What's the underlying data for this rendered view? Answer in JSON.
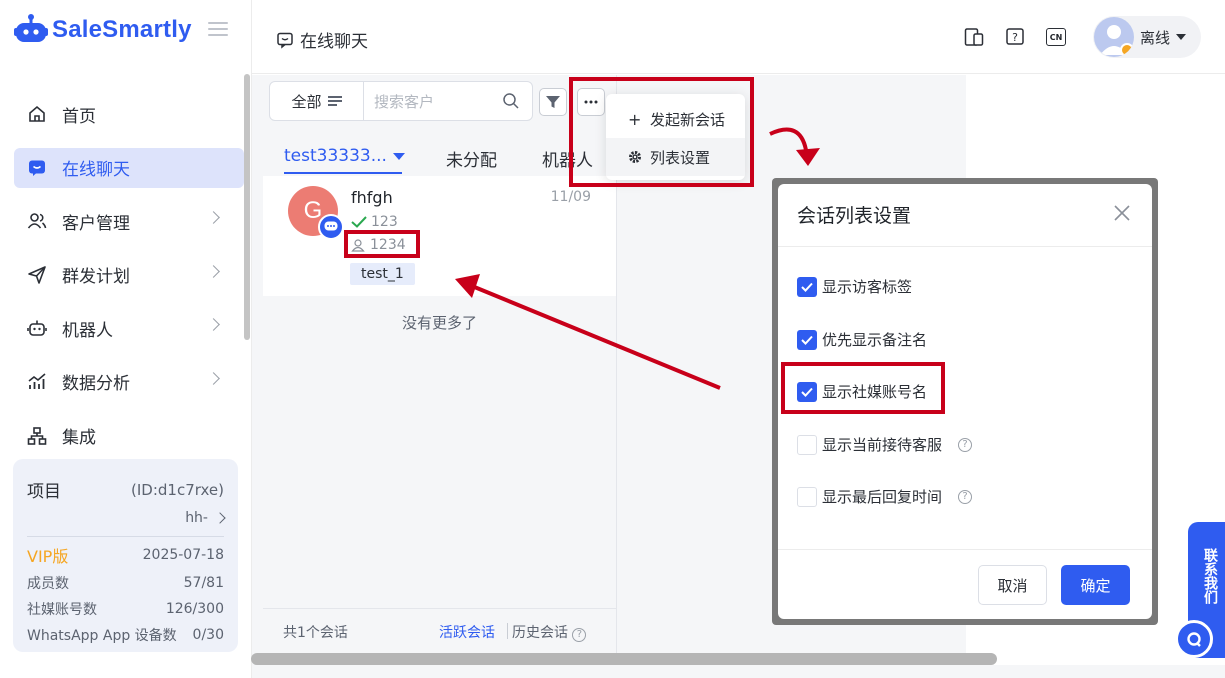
{
  "app": {
    "brand": "SaleSmartly",
    "accent": "#2f5cf0",
    "highlight_color": "#c8001a"
  },
  "sidebar": {
    "items": [
      {
        "label": "首页",
        "icon": "home-icon",
        "active": false,
        "has_arrow": false
      },
      {
        "label": "在线聊天",
        "icon": "chat-icon",
        "active": true,
        "has_arrow": false
      },
      {
        "label": "客户管理",
        "icon": "users-icon",
        "active": false,
        "has_arrow": true
      },
      {
        "label": "群发计划",
        "icon": "send-icon",
        "active": false,
        "has_arrow": true
      },
      {
        "label": "机器人",
        "icon": "robot-icon",
        "active": false,
        "has_arrow": true
      },
      {
        "label": "数据分析",
        "icon": "analytics-icon",
        "active": false,
        "has_arrow": true
      },
      {
        "label": "集成",
        "icon": "integration-icon",
        "active": false,
        "has_arrow": false
      }
    ],
    "project": {
      "label": "项目",
      "id": "(ID:d1c7rxe)",
      "name": "hh-",
      "plan": "VIP版",
      "plan_date": "2025-07-18",
      "stats": [
        {
          "label": "成员数",
          "value": "57/81"
        },
        {
          "label": "社媒账号数",
          "value": "126/300"
        },
        {
          "label": "WhatsApp App 设备数",
          "value": "0/30"
        }
      ]
    }
  },
  "header": {
    "title": "在线聊天",
    "lang_badge": "CN",
    "user_status": "离线"
  },
  "conversation_list": {
    "filter_label": "全部",
    "search_placeholder": "搜索客户",
    "tabs": [
      {
        "label": "test33333...",
        "active": true
      },
      {
        "label": "未分配",
        "active": false
      },
      {
        "label": "机器人",
        "active": false
      }
    ],
    "items": [
      {
        "avatar_letter": "G",
        "name": "fhfgh",
        "date": "11/09",
        "line1": "123",
        "line2": "1234",
        "tag": "test_1"
      }
    ],
    "no_more": "没有更多了",
    "footer": {
      "count": "共1个会话",
      "active": "活跃会话",
      "history": "历史会话"
    }
  },
  "more_menu": {
    "items": [
      {
        "label": "发起新会话",
        "icon": "plus-icon"
      },
      {
        "label": "列表设置",
        "icon": "gear-icon"
      }
    ]
  },
  "modal": {
    "title": "会话列表设置",
    "options": [
      {
        "label": "显示访客标签",
        "checked": true,
        "help": false
      },
      {
        "label": "优先显示备注名",
        "checked": true,
        "help": false
      },
      {
        "label": "显示社媒账号名",
        "checked": true,
        "help": false
      },
      {
        "label": "显示当前接待客服",
        "checked": false,
        "help": true
      },
      {
        "label": "显示最后回复时间",
        "checked": false,
        "help": true
      }
    ],
    "cancel": "取消",
    "confirm": "确定"
  },
  "contact_widget": {
    "label": "联系我们"
  }
}
